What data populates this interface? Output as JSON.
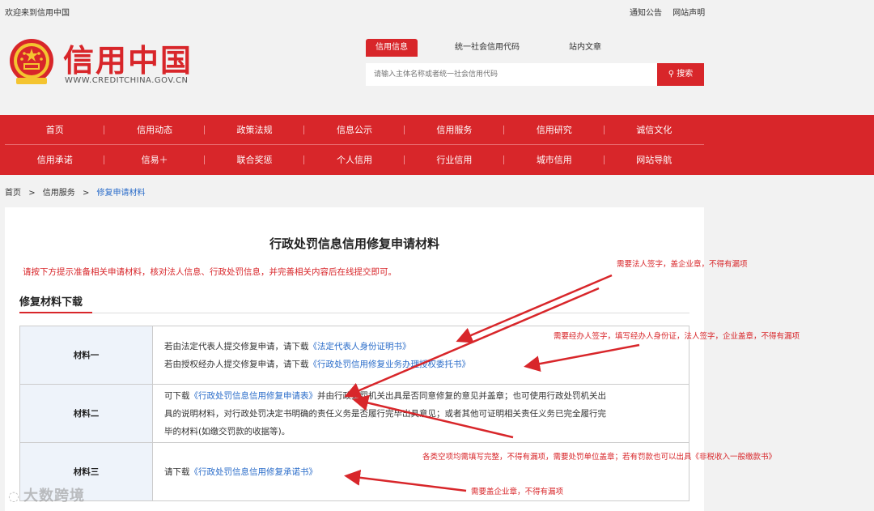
{
  "topbar": {
    "welcome": "欢迎来到信用中国",
    "links": [
      "通知公告",
      "网站声明"
    ]
  },
  "brand": {
    "title": "信用中国",
    "url": "WWW.CREDITCHINA.GOV.CN",
    "emblem_color": "#d8262a"
  },
  "search": {
    "tabs": [
      "信用信息",
      "统一社会信用代码",
      "站内文章"
    ],
    "active_tab": "信用信息",
    "placeholder": "请输入主体名称或者统一社会信用代码",
    "button": "搜索"
  },
  "nav": {
    "row1": [
      "首页",
      "信用动态",
      "政策法规",
      "信息公示",
      "信用服务",
      "信用研究",
      "诚信文化"
    ],
    "row2": [
      "信用承诺",
      "信易＋",
      "联合奖惩",
      "个人信用",
      "行业信用",
      "城市信用",
      "网站导航"
    ]
  },
  "breadcrumb": {
    "items": [
      "首页",
      "信用服务"
    ],
    "current": "修复申请材料",
    "sep": ">"
  },
  "main": {
    "title": "行政处罚信息信用修复申请材料",
    "intro": "请按下方提示准备相关申请材料，核对法人信息、行政处罚信息，并完善相关内容后在线提交即可。",
    "section_title": "修复材料下载",
    "materials": [
      {
        "label": "材料一",
        "line1_prefix": "若由法定代表人提交修复申请，请下载",
        "line1_link": "《法定代表人身份证明书》",
        "line2_prefix": "若由授权经办人提交修复申请，请下载",
        "line2_link": "《行政处罚信用修复业务办理授权委托书》"
      },
      {
        "label": "材料二",
        "prefix": "可下载",
        "link": "《行政处罚信息信用修复申请表》",
        "suffix1": "并由行政处罚机关出具是否同意修复的意见并盖章；也可使用行政处罚机关出",
        "line2": "具的说明材料，对行政处罚决定书明确的责任义务是否履行完毕出具意见；或者其他可证明相关责任义务已完全履行完",
        "line3": "毕的材料(如缴交罚款的收据等)。"
      },
      {
        "label": "材料三",
        "prefix": "请下载",
        "link": "《行政处罚信息信用修复承诺书》"
      }
    ]
  },
  "annotations": {
    "a1": "需要法人签字，盖企业章，不得有漏项",
    "a2": "需要经办人签字，填写经办人身份证，法人签字，企业盖章，不得有漏项",
    "a3": "各类空项均需填写完整，不得有漏项，需要处罚单位盖章；若有罚款也可以出具《非税收入一般缴款书》",
    "a4": "需要盖企业章，不得有漏项"
  },
  "watermark": "大数跨境",
  "colors": {
    "brand_red": "#d8262a",
    "link_blue": "#2a6cc9",
    "label_bg": "#eef3fa"
  }
}
